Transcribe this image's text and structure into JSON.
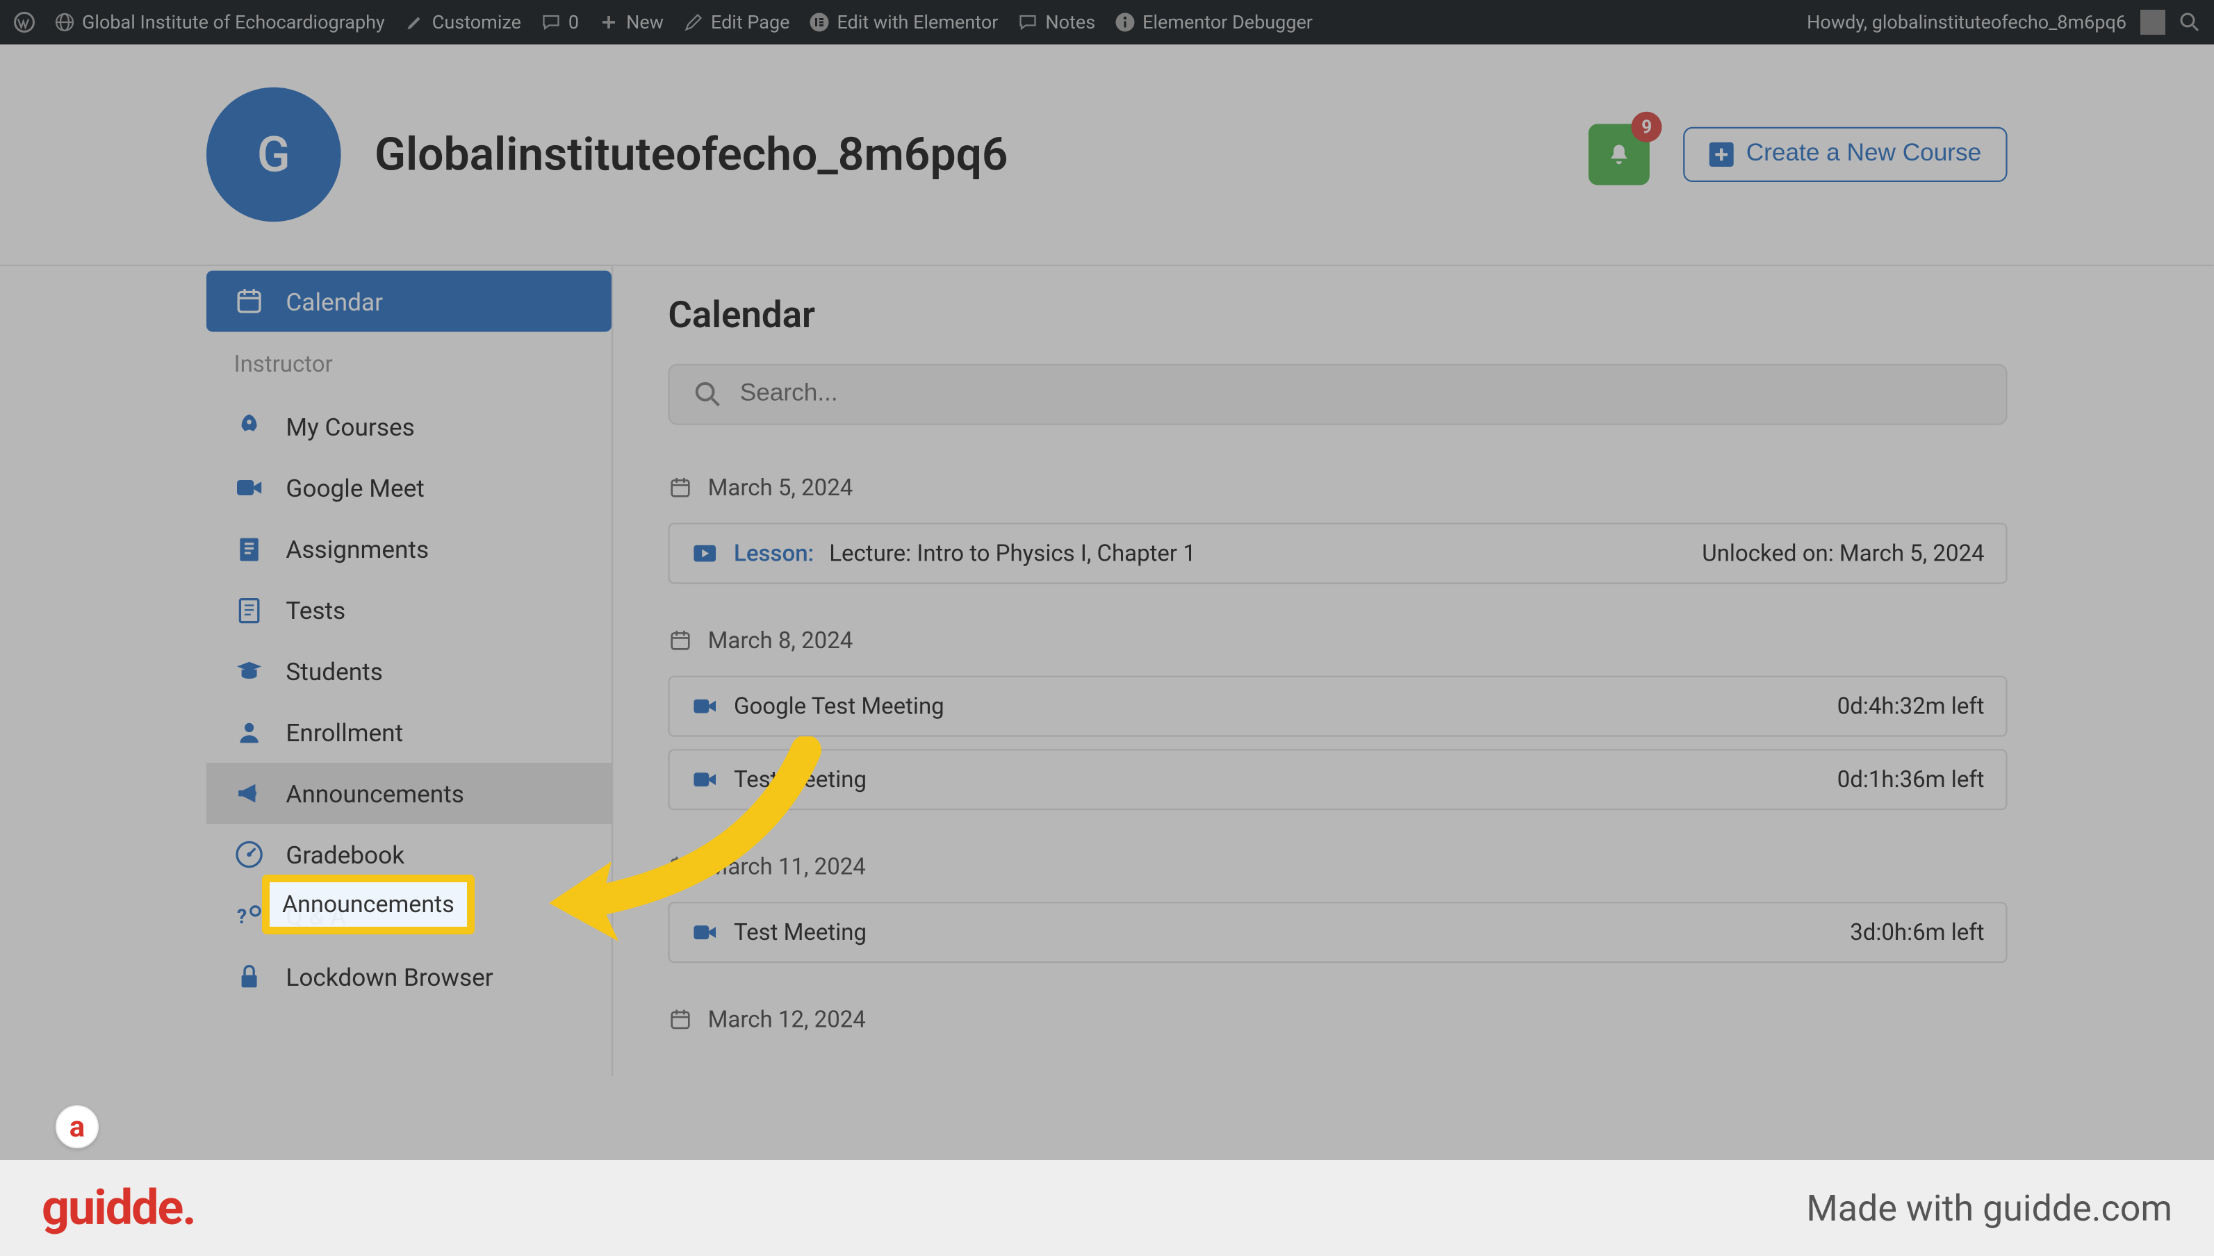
{
  "adminbar": {
    "site_name": "Global Institute of Echocardiography",
    "customize": "Customize",
    "comments": "0",
    "new": "New",
    "edit_page": "Edit Page",
    "edit_elementor": "Edit with Elementor",
    "notes": "Notes",
    "debugger": "Elementor Debugger",
    "howdy": "Howdy, globalinstituteofecho_8m6pq6"
  },
  "header": {
    "avatar_letter": "G",
    "title": "Globalinstituteofecho_8m6pq6",
    "badge_count": "9",
    "create_btn": "Create a New Course"
  },
  "sidebar": {
    "calendar": "Calendar",
    "section_instructor": "Instructor",
    "my_courses": "My Courses",
    "google_meet": "Google Meet",
    "assignments": "Assignments",
    "tests": "Tests",
    "students": "Students",
    "enrollment": "Enrollment",
    "announcements": "Announcements",
    "gradebook": "Gradebook",
    "qa": "Q & A",
    "lockdown": "Lockdown Browser"
  },
  "main": {
    "title": "Calendar",
    "search_placeholder": "Search..."
  },
  "calendar": [
    {
      "date": "March 5, 2024",
      "items": [
        {
          "prefix": "Lesson:",
          "title": "Lecture: Intro to Physics I, Chapter 1",
          "right": "Unlocked on: March 5, 2024",
          "icon": "play"
        }
      ]
    },
    {
      "date": "March 8, 2024",
      "items": [
        {
          "prefix": "",
          "title": "Google Test Meeting",
          "right": "0d:4h:32m left",
          "icon": "cam"
        },
        {
          "prefix": "",
          "title": "Test Meeting",
          "right": "0d:1h:36m left",
          "icon": "cam"
        }
      ]
    },
    {
      "date": "March 11, 2024",
      "items": [
        {
          "prefix": "",
          "title": "Test Meeting",
          "right": "3d:0h:6m left",
          "icon": "cam"
        }
      ]
    },
    {
      "date": "March 12, 2024",
      "items": []
    }
  ],
  "footer": {
    "logo": "guidde.",
    "made": "Made with guidde.com"
  }
}
